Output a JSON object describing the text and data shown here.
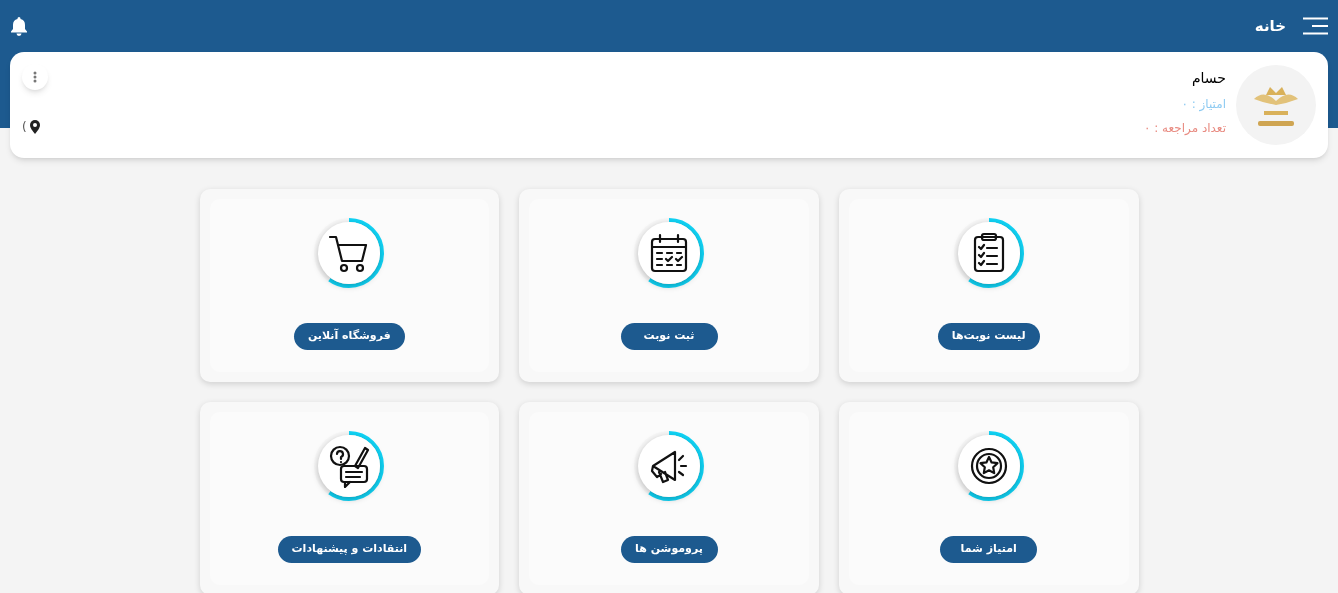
{
  "header": {
    "title": "خانه"
  },
  "profile": {
    "name": "حسام",
    "points": "امتیاز : ۰",
    "visits": "تعداد مراجعه : ۰",
    "location": "("
  },
  "tiles": [
    {
      "kind": "clipboard",
      "label": "لیست نوبت‌ها"
    },
    {
      "kind": "calendar",
      "label": "ثبت نوبت"
    },
    {
      "kind": "cart",
      "label": "فروشگاه آنلاین"
    },
    {
      "kind": "medal",
      "label": "امتیاز شما"
    },
    {
      "kind": "megaphone",
      "label": "پروموشن ها"
    },
    {
      "kind": "feedback",
      "label": "انتقادات و پیشنهادات"
    }
  ]
}
